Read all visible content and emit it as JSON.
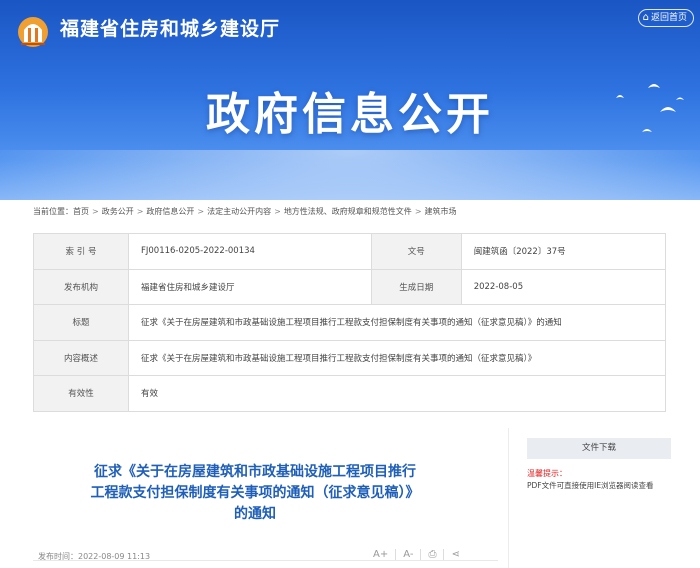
{
  "header": {
    "site_name": "福建省住房和城乡建设厅",
    "back_home": "返回首页",
    "banner_title": "政府信息公开"
  },
  "breadcrumb": {
    "items": [
      "当前位置：首页",
      "政务公开",
      "政府信息公开",
      "法定主动公开内容",
      "地方性法规、政府规章和规范性文件",
      "建筑市场"
    ]
  },
  "info": {
    "index_label": "索 引 号",
    "index_value": "FJ00116-0205-2022-00134",
    "docno_label": "文号",
    "docno_value": "闽建筑函〔2022〕37号",
    "issuer_label": "发布机构",
    "issuer_value": "福建省住房和城乡建设厅",
    "date_label": "生成日期",
    "date_value": "2022-08-05",
    "title_label": "标题",
    "title_value": "征求《关于在房屋建筑和市政基础设施工程项目推行工程款支付担保制度有关事项的通知（征求意见稿）》的通知",
    "summary_label": "内容概述",
    "summary_value": "征求《关于在房屋建筑和市政基础设施工程项目推行工程款支付担保制度有关事项的通知（征求意见稿）》",
    "validity_label": "有效性",
    "validity_value": "有效"
  },
  "article": {
    "title": "征求《关于在房屋建筑和市政基础设施工程项目推行工程款支付担保制度有关事项的通知（征求意见稿）》的通知",
    "publish_time": "发布时间：2022-08-09 11:13",
    "tools": {
      "font_up": "A+",
      "font_down": "A-",
      "print": "⎙",
      "share": "⋖"
    }
  },
  "sidebar": {
    "download_title": "文件下载",
    "tip_title": "温馨提示：",
    "tip_text": "PDF文件可直接使用IE浏览器阅读查看"
  },
  "colors": {
    "banner": "#2e72e0",
    "title_blue": "#1f5fb8",
    "tip_red": "#e02020"
  }
}
